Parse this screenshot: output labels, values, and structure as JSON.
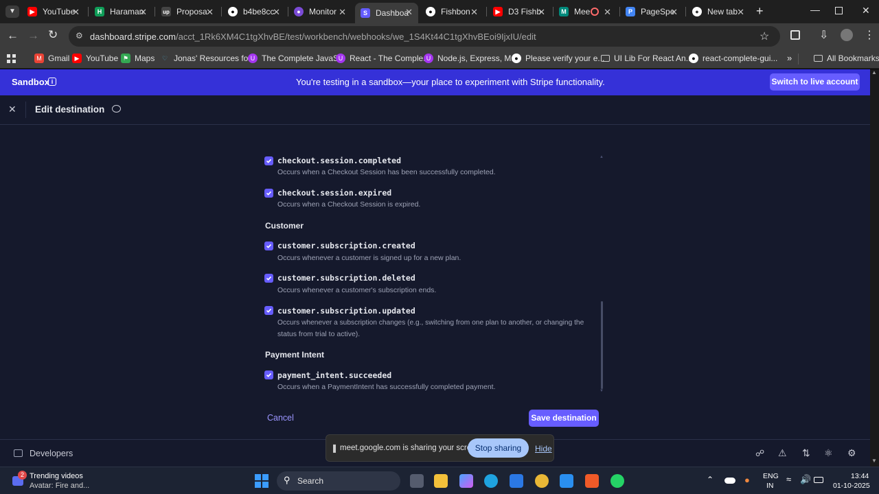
{
  "browser": {
    "tabs": [
      {
        "label": "YouTube",
        "icon": "youtube-icon",
        "color": "#ff0000"
      },
      {
        "label": "Haraman",
        "icon": "app-icon",
        "color": "#0f9d58"
      },
      {
        "label": "Proposa",
        "icon": "upwork-icon",
        "color": "#444444"
      },
      {
        "label": "b4be8cc",
        "icon": "github-icon",
        "color": "#ffffff"
      },
      {
        "label": "Monitor",
        "icon": "monitor-icon",
        "color": "#7b4bd6"
      },
      {
        "label": "Dashboa",
        "icon": "stripe-icon",
        "color": "#635bff"
      },
      {
        "label": "Fishbon",
        "icon": "github-icon",
        "color": "#ffffff"
      },
      {
        "label": "D3 Fishb",
        "icon": "youtube-icon",
        "color": "#ff0000"
      },
      {
        "label": "Mee",
        "icon": "meet-icon",
        "color": "#00897b"
      },
      {
        "label": "PageSpe",
        "icon": "pagespeed-icon",
        "color": "#4285f4"
      },
      {
        "label": "New tab",
        "icon": "chrome-icon",
        "color": "#ffffff"
      }
    ],
    "url_host": "dashboard.stripe.com",
    "url_path": "/acct_1Rk6XM4C1tgXhvBE/test/workbench/webhooks/we_1S4Kt44C1tgXhvBEoi9IjxIU/edit",
    "bookmarks": [
      {
        "label": "Gmail",
        "icon": "gmail-icon",
        "color": "#ea4335"
      },
      {
        "label": "YouTube",
        "icon": "youtube-icon",
        "color": "#ff0000"
      },
      {
        "label": "Maps",
        "icon": "maps-icon",
        "color": "#34a853"
      },
      {
        "label": "Jonas' Resources for...",
        "icon": "heart-icon",
        "color": "#4ba3c7"
      },
      {
        "label": "The Complete JavaS...",
        "icon": "udemy-icon",
        "color": "#a435f0"
      },
      {
        "label": "React - The Comple...",
        "icon": "udemy-icon",
        "color": "#a435f0"
      },
      {
        "label": "Node.js, Express, M...",
        "icon": "udemy-icon",
        "color": "#a435f0"
      },
      {
        "label": "Please verify your e...",
        "icon": "github-icon",
        "color": "#ffffff"
      },
      {
        "label": "UI Lib For React An...",
        "icon": "folder-icon",
        "color": "#cccccc"
      },
      {
        "label": "react-complete-gui...",
        "icon": "github-icon",
        "color": "#ffffff"
      }
    ],
    "all_bookmarks": "All Bookmarks"
  },
  "sandbox": {
    "label": "Sandbox",
    "message": "You're testing in a sandbox—your place to experiment with Stripe functionality.",
    "switch_button": "Switch to live account"
  },
  "header": {
    "title": "Edit destination"
  },
  "events": {
    "checkout_completed": {
      "name": "checkout.session.completed",
      "desc": "Occurs when a Checkout Session has been successfully completed."
    },
    "checkout_expired": {
      "name": "checkout.session.expired",
      "desc": "Occurs when a Checkout Session is expired."
    },
    "customer_group": "Customer",
    "sub_created": {
      "name": "customer.subscription.created",
      "desc": "Occurs whenever a customer is signed up for a new plan."
    },
    "sub_deleted": {
      "name": "customer.subscription.deleted",
      "desc": "Occurs whenever a customer's subscription ends."
    },
    "sub_updated": {
      "name": "customer.subscription.updated",
      "desc_line1": "Occurs whenever a subscription changes (e.g., switching from one plan to another, or changing the",
      "desc_line2": "status from trial to active)."
    },
    "payment_group": "Payment Intent",
    "pi_succeeded": {
      "name": "payment_intent.succeeded",
      "desc": "Occurs when a PaymentIntent has successfully completed payment."
    }
  },
  "actions": {
    "cancel": "Cancel",
    "save": "Save destination"
  },
  "footer": {
    "developers": "Developers"
  },
  "share": {
    "message": "meet.google.com is sharing your screen.",
    "stop": "Stop sharing",
    "hide": "Hide"
  },
  "taskbar": {
    "news_badge": "2",
    "news_title": "Trending videos",
    "news_sub": "Avatar: Fire and...",
    "search": "Search",
    "lang1": "ENG",
    "lang2": "IN",
    "time": "13:44",
    "date": "01-10-2025"
  },
  "colors": {
    "accent": "#675dff",
    "sandbox_bar": "#3531d8",
    "page_bg": "#15192c"
  }
}
